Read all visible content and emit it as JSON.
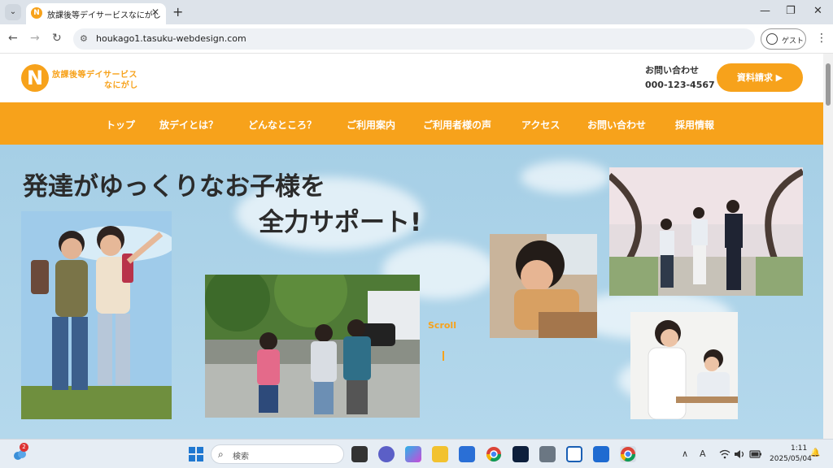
{
  "browser": {
    "tab_title": "放課後等デイサービスなにがし",
    "favicon_letter": "N",
    "tab_close": "✕",
    "new_tab": "+",
    "tab_menu": "⌄",
    "url": "houkago1.tasuku-webdesign.com",
    "profile_label": "ゲスト",
    "back": "←",
    "forward": "→",
    "reload": "↻",
    "site_info": "⚙",
    "menu": "⋮",
    "minimize": "—",
    "restore": "❐",
    "close": "✕"
  },
  "site": {
    "logo_letter": "N",
    "logo_line1": "放課後等デイサービス",
    "logo_line2": "なにがし",
    "contact_label": "お問い合わせ",
    "contact_phone": "000-123-4567",
    "doc_request": "資料請求 ▶"
  },
  "nav": [
    "トップ",
    "放デイとは？",
    "どんなところ？",
    "ご利用案内",
    "ご利用者様の声",
    "アクセス",
    "お問い合わせ",
    "採用情報"
  ],
  "hero": {
    "title_line1": "発達がゆっくりなお子様を",
    "title_line2": "全力サポート!",
    "scroll_label": "Scroll"
  },
  "taskbar": {
    "notification_count": "2",
    "search_placeholder": "検索",
    "search_icon": "⌕",
    "time": "1:11",
    "date": "2025/05/04",
    "chevron": "∧",
    "bell": "🔔"
  },
  "colors": {
    "accent": "#f7a21b",
    "sky": "#a7d0e6"
  }
}
